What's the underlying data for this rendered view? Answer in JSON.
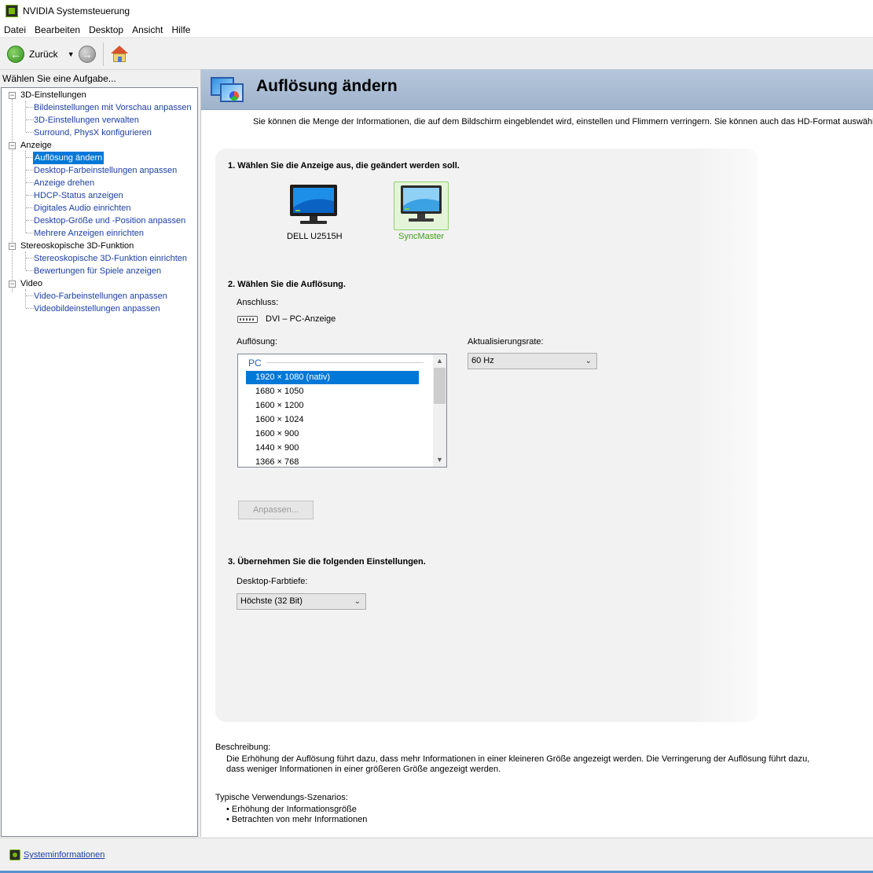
{
  "window": {
    "title": "NVIDIA Systemsteuerung"
  },
  "menu": {
    "items": [
      "Datei",
      "Bearbeiten",
      "Desktop",
      "Ansicht",
      "Hilfe"
    ]
  },
  "toolbar": {
    "back_label": "Zurück"
  },
  "sidebar": {
    "header": "Wählen Sie eine Aufgabe...",
    "categories": [
      {
        "label": "3D-Einstellungen",
        "items": [
          "Bildeinstellungen mit Vorschau anpassen",
          "3D-Einstellungen verwalten",
          "Surround, PhysX konfigurieren"
        ]
      },
      {
        "label": "Anzeige",
        "items": [
          "Auflösung ändern",
          "Desktop-Farbeinstellungen anpassen",
          "Anzeige drehen",
          "HDCP-Status anzeigen",
          "Digitales Audio einrichten",
          "Desktop-Größe und -Position anpassen",
          "Mehrere Anzeigen einrichten"
        ]
      },
      {
        "label": "Stereoskopische 3D-Funktion",
        "items": [
          "Stereoskopische 3D-Funktion einrichten",
          "Bewertungen für Spiele anzeigen"
        ]
      },
      {
        "label": "Video",
        "items": [
          "Video-Farbeinstellungen anpassen",
          "Videobildeinstellungen anpassen"
        ]
      }
    ],
    "selected": "Auflösung ändern"
  },
  "page": {
    "title": "Auflösung ändern",
    "intro": "Sie können die Menge der Informationen, die auf dem Bildschirm eingeblendet wird, einstellen und Flimmern verringern. Sie können auch das HD-Format auswählen, wer",
    "step1": {
      "title": "1. Wählen Sie die Anzeige aus, die geändert werden soll.",
      "displays": [
        {
          "name": "DELL U2515H",
          "selected": false
        },
        {
          "name": "SyncMaster",
          "selected": true
        }
      ]
    },
    "step2": {
      "title": "2. Wählen Sie die Auflösung.",
      "connection_label": "Anschluss:",
      "connection_value": "DVI – PC-Anzeige",
      "resolution_label": "Auflösung:",
      "group": "PC",
      "resolutions": [
        "1920 × 1080 (nativ)",
        "1680 × 1050",
        "1600 × 1200",
        "1600 × 1024",
        "1600 × 900",
        "1440 × 900",
        "1366 × 768"
      ],
      "selected_resolution": "1920 × 1080 (nativ)",
      "refresh_label": "Aktualisierungsrate:",
      "refresh_value": "60 Hz",
      "customize_button": "Anpassen..."
    },
    "step3": {
      "title": "3. Übernehmen Sie die folgenden Einstellungen.",
      "color_depth_label": "Desktop-Farbtiefe:",
      "color_depth_value": "Höchste (32 Bit)"
    },
    "description": {
      "heading": "Beschreibung:",
      "text": "Die Erhöhung der Auflösung führt dazu, dass mehr Informationen in einer kleineren Größe angezeigt werden. Die Verringerung der Auflösung führt dazu, dass weniger Informationen in einer größeren Größe angezeigt werden."
    },
    "scenarios": {
      "heading": "Typische Verwendungs-Szenarios:",
      "items": [
        "Erhöhung der Informationsgröße",
        "Betrachten von mehr Informationen"
      ]
    }
  },
  "footer": {
    "sysinfo_link": "Systeminformationen"
  },
  "colors": {
    "accent_selected": "#0078d7",
    "link": "#1b3fa6",
    "nvidia_green": "#76b900",
    "banner": "#a9bcd4"
  }
}
